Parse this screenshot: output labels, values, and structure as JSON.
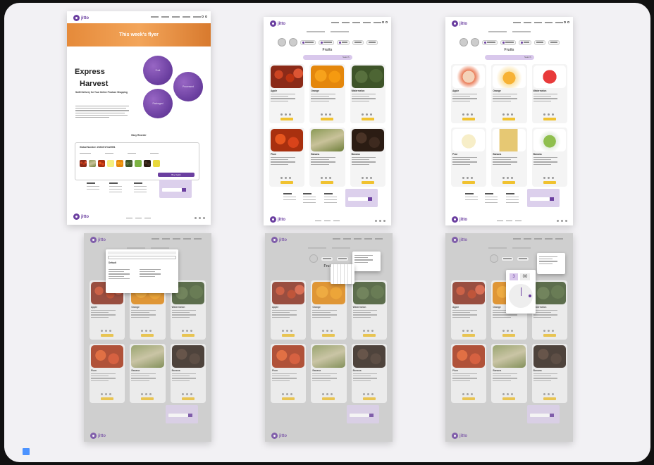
{
  "brand": {
    "logo": "jitto",
    "accent": "#6b3fa0",
    "accent_light": "#d9c8ec",
    "yellow": "#f0c230"
  },
  "flyer": {
    "banner": "This week's flyer",
    "hero_line1": "Express",
    "hero_line2": "Harvest",
    "subtitle": "Swift Delivery for Your Online Produce Shopping",
    "bubbles": [
      "Fruit",
      "Processed",
      "Packaged"
    ],
    "form_heading": "Easy Reorder",
    "order_number": "Global Number: 2023471714/2551",
    "buy_button": "Buy Again"
  },
  "product_page": {
    "title": "Fruits",
    "search": "Search",
    "products_fresh": [
      {
        "name": "Apple",
        "img": "apple"
      },
      {
        "name": "Orange",
        "img": "orange"
      },
      {
        "name": "Watermelon",
        "img": "melon"
      },
      {
        "name": "Plum",
        "img": "plum"
      },
      {
        "name": "Banana",
        "img": "banana"
      },
      {
        "name": "Banana",
        "img": "dark"
      }
    ],
    "products_processed": [
      {
        "name": "Apple",
        "img": "slice"
      },
      {
        "name": "Orange",
        "img": "oslice"
      },
      {
        "name": "Watermelon",
        "img": "wcube"
      },
      {
        "name": "Pear",
        "img": "bowl"
      },
      {
        "name": "Banana",
        "img": "bag"
      },
      {
        "name": "Banana",
        "img": "tub"
      }
    ]
  },
  "overlays": {
    "address_popup_title": "Default",
    "time_value": "3",
    "minutes_value": "00"
  }
}
